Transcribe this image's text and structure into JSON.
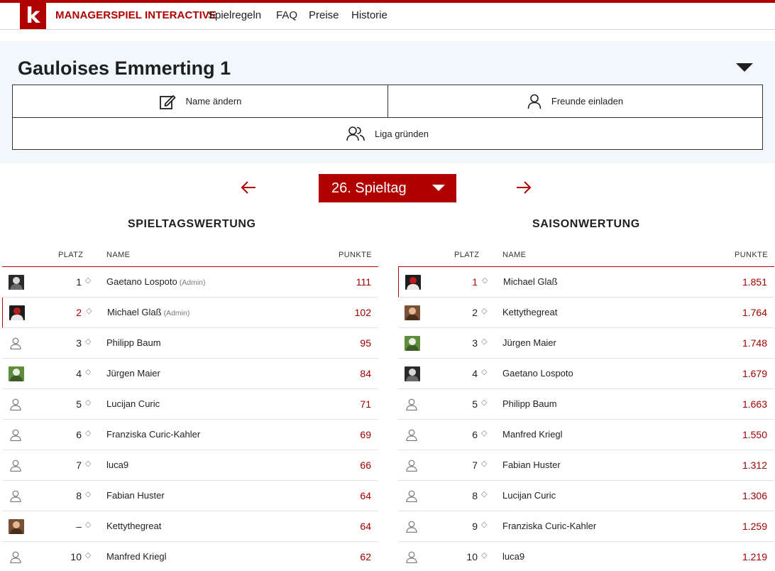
{
  "header": {
    "logo": "k",
    "brand": "MANAGERSPIEL INTERACTIVE",
    "nav": [
      "Spielregeln",
      "FAQ",
      "Preise",
      "Historie"
    ]
  },
  "team": {
    "title": "Gauloises Emmerting 1",
    "buttons": {
      "rename": "Name ändern",
      "invite": "Freunde einladen",
      "league": "Liga gründen"
    }
  },
  "matchday": {
    "label": "26. Spieltag"
  },
  "colors": {
    "accent": "#b00000",
    "panel": "#f1f7fa"
  },
  "spieltag": {
    "title": "SPIELTAGSWERTUNG",
    "headers": {
      "place": "PLATZ",
      "name": "NAME",
      "points": "PUNKTE"
    },
    "rows": [
      {
        "place": "1",
        "name": "Gaetano Lospoto",
        "tag": "(Admin)",
        "points": "111",
        "avatar": "photo-bw"
      },
      {
        "place": "2",
        "name": "Michael Glaß",
        "tag": "(Admin)",
        "points": "102",
        "avatar": "photo-red"
      },
      {
        "place": "3",
        "name": "Philipp Baum",
        "tag": "",
        "points": "95",
        "avatar": "person-icon"
      },
      {
        "place": "4",
        "name": "Jürgen Maier",
        "tag": "",
        "points": "84",
        "avatar": "photo-green"
      },
      {
        "place": "5",
        "name": "Lucijan Curic",
        "tag": "",
        "points": "71",
        "avatar": "person-icon"
      },
      {
        "place": "6",
        "name": "Franziska Curic-Kahler",
        "tag": "",
        "points": "69",
        "avatar": "person-icon"
      },
      {
        "place": "7",
        "name": "luca9",
        "tag": "",
        "points": "66",
        "avatar": "person-icon"
      },
      {
        "place": "8",
        "name": "Fabian Huster",
        "tag": "",
        "points": "64",
        "avatar": "person-icon"
      },
      {
        "place": "–",
        "name": "Kettythegreat",
        "tag": "",
        "points": "64",
        "avatar": "photo-face"
      },
      {
        "place": "10",
        "name": "Manfred Kriegl",
        "tag": "",
        "points": "62",
        "avatar": "person-icon"
      }
    ]
  },
  "saison": {
    "title": "SAISONWERTUNG",
    "headers": {
      "place": "PLATZ",
      "name": "NAME",
      "points": "PUNKTE"
    },
    "rows": [
      {
        "place": "1",
        "name": "Michael Glaß",
        "tag": "",
        "points": "1.851",
        "avatar": "photo-red"
      },
      {
        "place": "2",
        "name": "Kettythegreat",
        "tag": "",
        "points": "1.764",
        "avatar": "photo-face"
      },
      {
        "place": "3",
        "name": "Jürgen Maier",
        "tag": "",
        "points": "1.748",
        "avatar": "photo-green"
      },
      {
        "place": "4",
        "name": "Gaetano Lospoto",
        "tag": "",
        "points": "1.679",
        "avatar": "photo-bw"
      },
      {
        "place": "5",
        "name": "Philipp Baum",
        "tag": "",
        "points": "1.663",
        "avatar": "person-icon"
      },
      {
        "place": "6",
        "name": "Manfred Kriegl",
        "tag": "",
        "points": "1.550",
        "avatar": "person-icon"
      },
      {
        "place": "7",
        "name": "Fabian Huster",
        "tag": "",
        "points": "1.312",
        "avatar": "person-icon"
      },
      {
        "place": "8",
        "name": "Lucijan Curic",
        "tag": "",
        "points": "1.306",
        "avatar": "person-icon"
      },
      {
        "place": "9",
        "name": "Franziska Curic-Kahler",
        "tag": "",
        "points": "1.259",
        "avatar": "person-icon"
      },
      {
        "place": "10",
        "name": "luca9",
        "tag": "",
        "points": "1.219",
        "avatar": "person-icon"
      }
    ]
  }
}
